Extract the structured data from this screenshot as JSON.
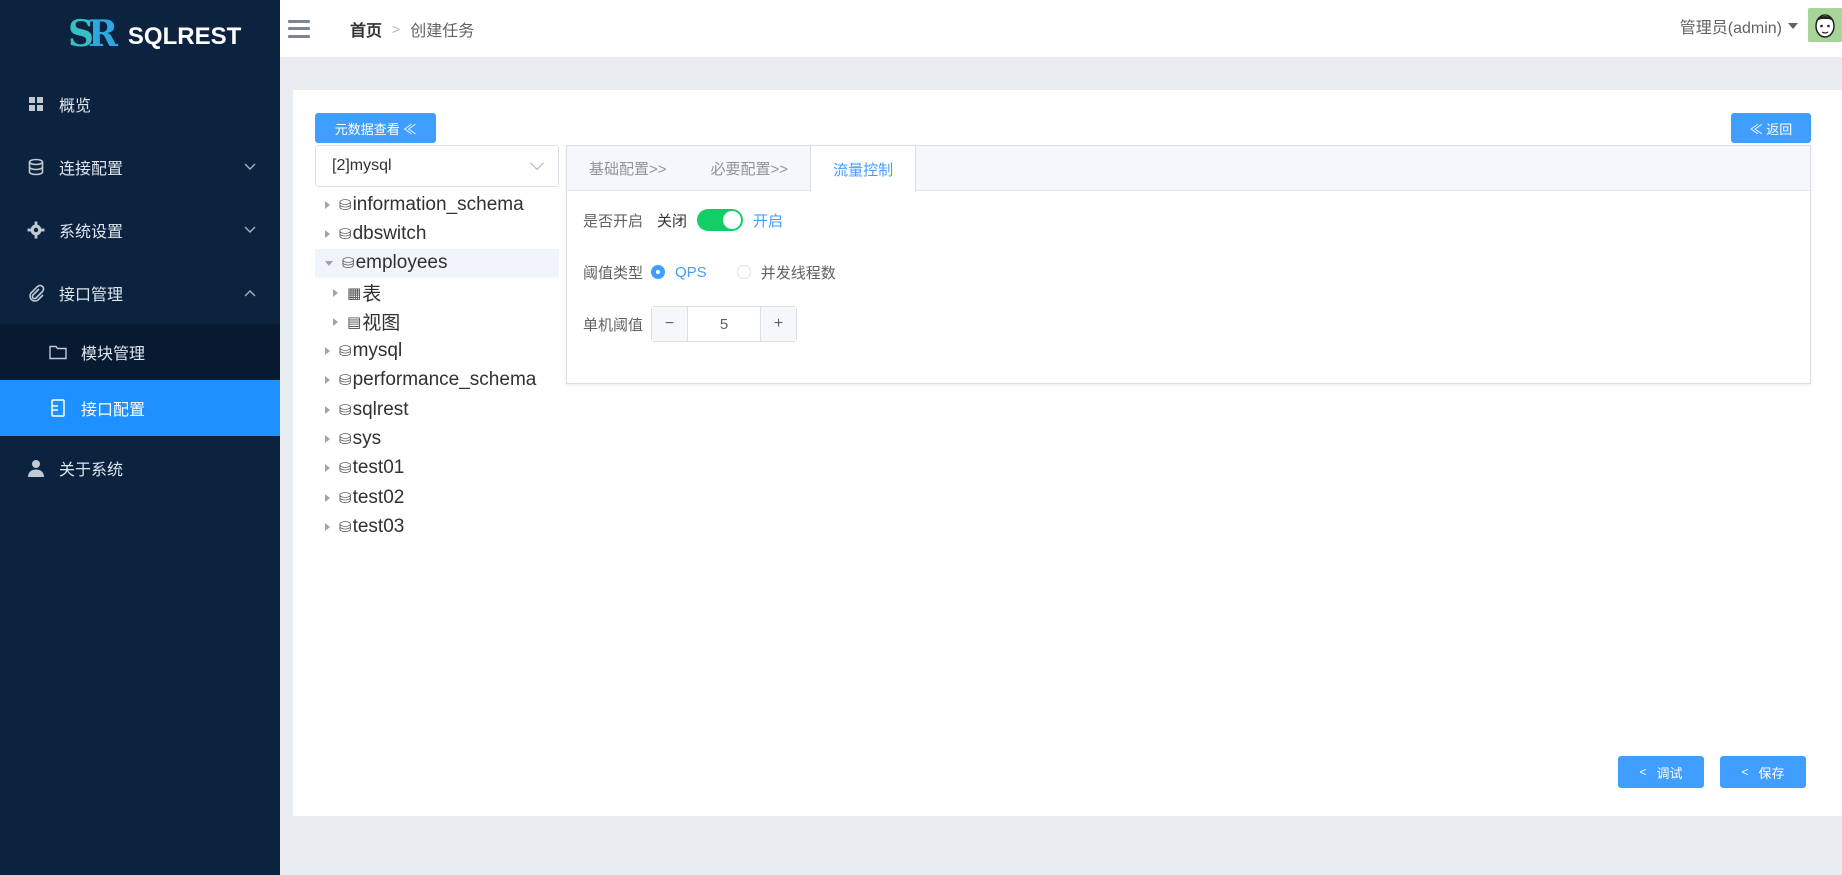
{
  "app": {
    "logo_mark_a": "S",
    "logo_mark_b": "R",
    "name": "SQLREST"
  },
  "sidebar": {
    "items": [
      {
        "label": "概览",
        "icon": "grid-icon"
      },
      {
        "label": "连接配置",
        "icon": "database-icon"
      },
      {
        "label": "系统设置",
        "icon": "gear-icon"
      },
      {
        "label": "接口管理",
        "icon": "paperclip-icon"
      },
      {
        "label": "模块管理",
        "icon": "folder-icon"
      },
      {
        "label": "接口配置",
        "icon": "document-icon"
      },
      {
        "label": "关于系统",
        "icon": "user-icon"
      }
    ]
  },
  "header": {
    "breadcrumb": {
      "home": "首页",
      "separator": ">",
      "current": "创建任务"
    },
    "user": "管理员(admin)"
  },
  "toolbar": {
    "meta_button": "元数据查看 ≪",
    "back_button": "≪ 返回"
  },
  "datasource": {
    "selected": "[2]mysql"
  },
  "tree": {
    "nodes": [
      {
        "label": "information_schema",
        "icon": "⛁"
      },
      {
        "label": "dbswitch",
        "icon": "⛁"
      },
      {
        "label": "employees",
        "icon": "⛁"
      },
      {
        "label": "表",
        "icon": "▦"
      },
      {
        "label": "视图",
        "icon": "▤"
      },
      {
        "label": "mysql",
        "icon": "⛁"
      },
      {
        "label": "performance_schema",
        "icon": "⛁"
      },
      {
        "label": "sqlrest",
        "icon": "⛁"
      },
      {
        "label": "sys",
        "icon": "⛁"
      },
      {
        "label": "test01",
        "icon": "⛁"
      },
      {
        "label": "test02",
        "icon": "⛁"
      },
      {
        "label": "test03",
        "icon": "⛁"
      }
    ]
  },
  "tabs": [
    {
      "label": "基础配置>>"
    },
    {
      "label": "必要配置>>"
    },
    {
      "label": "流量控制"
    }
  ],
  "flow_control": {
    "enable_label": "是否开启",
    "switch_off": "关闭",
    "switch_on": "开启",
    "enabled": true,
    "threshold_type_label": "阈值类型",
    "option_qps": "QPS",
    "option_threads": "并发线程数",
    "selected_type": "QPS",
    "threshold_label": "单机阈值",
    "threshold_value": "5",
    "minus": "−",
    "plus": "+"
  },
  "actions": {
    "debug": "调试",
    "save": "保存",
    "chevron": "<"
  },
  "colors": {
    "sidebar_bg": "#0c2340",
    "active_item": "#1e90ff",
    "primary": "#409eff",
    "switch_on": "#13ce66"
  }
}
